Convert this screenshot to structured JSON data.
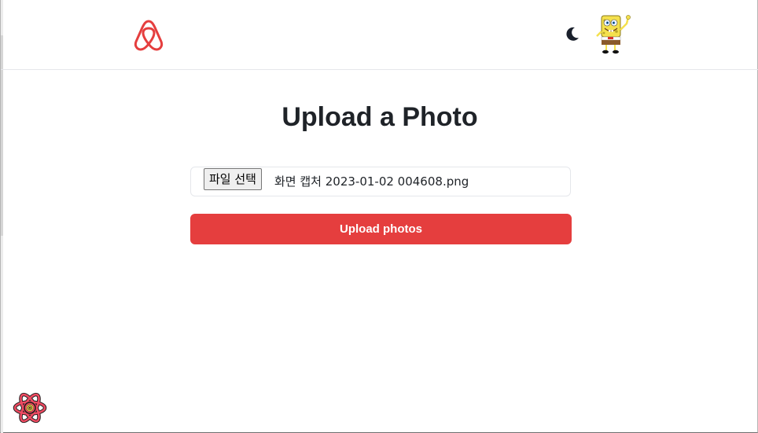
{
  "header": {
    "logo_icon": "airbnb-logo-icon",
    "theme_toggle_icon": "moon-icon",
    "avatar_icon": "spongebob-avatar-icon",
    "brand_color": "#e53e3e"
  },
  "main": {
    "title": "Upload a Photo",
    "file_input": {
      "button_label": "파일 선택",
      "selected_file": "화면 캡처 2023-01-02 004608.png"
    },
    "upload_button": "Upload photos"
  },
  "devtools": {
    "icon": "react-query-devtools-icon"
  }
}
